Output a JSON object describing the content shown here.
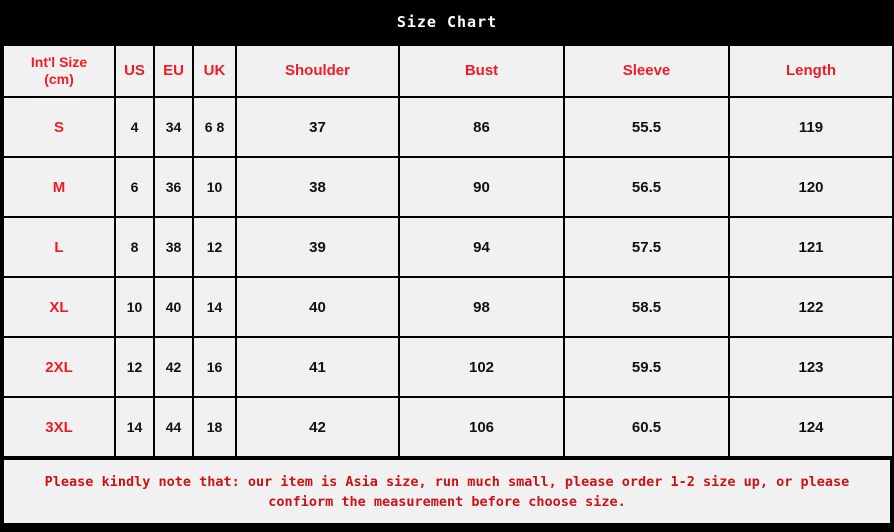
{
  "title": "Size Chart",
  "table": {
    "headers": {
      "intl_line1": "Int'l Size",
      "intl_line2": "(cm)",
      "us": "US",
      "eu": "EU",
      "uk": "UK",
      "shoulder": "Shoulder",
      "bust": "Bust",
      "sleeve": "Sleeve",
      "length": "Length"
    },
    "rows": [
      {
        "size": "S",
        "us": "4",
        "eu": "34",
        "uk": "6 8",
        "shoulder": "37",
        "bust": "86",
        "sleeve": "55.5",
        "length": "119"
      },
      {
        "size": "M",
        "us": "6",
        "eu": "36",
        "uk": "10",
        "shoulder": "38",
        "bust": "90",
        "sleeve": "56.5",
        "length": "120"
      },
      {
        "size": "L",
        "us": "8",
        "eu": "38",
        "uk": "12",
        "shoulder": "39",
        "bust": "94",
        "sleeve": "57.5",
        "length": "121"
      },
      {
        "size": "XL",
        "us": "10",
        "eu": "40",
        "uk": "14",
        "shoulder": "40",
        "bust": "98",
        "sleeve": "58.5",
        "length": "122"
      },
      {
        "size": "2XL",
        "us": "12",
        "eu": "42",
        "uk": "16",
        "shoulder": "41",
        "bust": "102",
        "sleeve": "59.5",
        "length": "123"
      },
      {
        "size": "3XL",
        "us": "14",
        "eu": "44",
        "uk": "18",
        "shoulder": "42",
        "bust": "106",
        "sleeve": "60.5",
        "length": "124"
      }
    ]
  },
  "note": "Please  kindly note that: our item is Asia size, run much small, please order 1-2 size up, or please confiorm the measurement before choose size.",
  "colors": {
    "background": "#000000",
    "cell_background": "#F1F1F1",
    "border": "#000000",
    "accent_red": "#EE1C25",
    "note_red": "#CC1117",
    "title_white": "#FFFFFF",
    "value_black": "#111111"
  }
}
